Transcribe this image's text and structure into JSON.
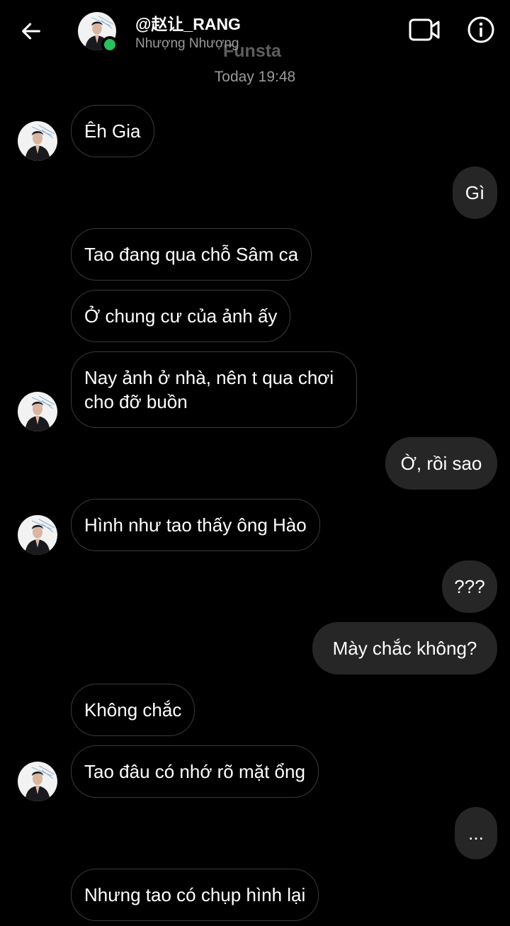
{
  "header": {
    "contact_name": "@赵让_RANG",
    "contact_subtitle": "Nhượng Nhượng",
    "overlay_name": "Funsta",
    "back_icon": "arrow-left-icon",
    "video_icon": "video-camera-icon",
    "info_icon": "info-icon",
    "online_color": "#29c15e"
  },
  "timestamp": "Today 19:48",
  "messages": [
    {
      "from": "them",
      "text": "Êh Gia"
    },
    {
      "from": "me",
      "text": "Gì"
    },
    {
      "from": "them",
      "text": "Tao đang qua chỗ Sâm ca"
    },
    {
      "from": "them",
      "text": "Ở chung cư của ảnh ấy"
    },
    {
      "from": "them",
      "text": "Nay ảnh ở nhà, nên t qua chơi cho đỡ buồn"
    },
    {
      "from": "me",
      "text": "Ờ, rồi sao"
    },
    {
      "from": "them",
      "text": "Hình như tao thấy ông Hào"
    },
    {
      "from": "me",
      "text": "???"
    },
    {
      "from": "me",
      "text": "Mày chắc không?"
    },
    {
      "from": "them",
      "text": "Không chắc"
    },
    {
      "from": "them",
      "text": "Tao đâu có nhớ rõ mặt ổng"
    },
    {
      "from": "me",
      "text": "..."
    },
    {
      "from": "them",
      "text": "Nhưng tao có chụp hình lại"
    }
  ]
}
